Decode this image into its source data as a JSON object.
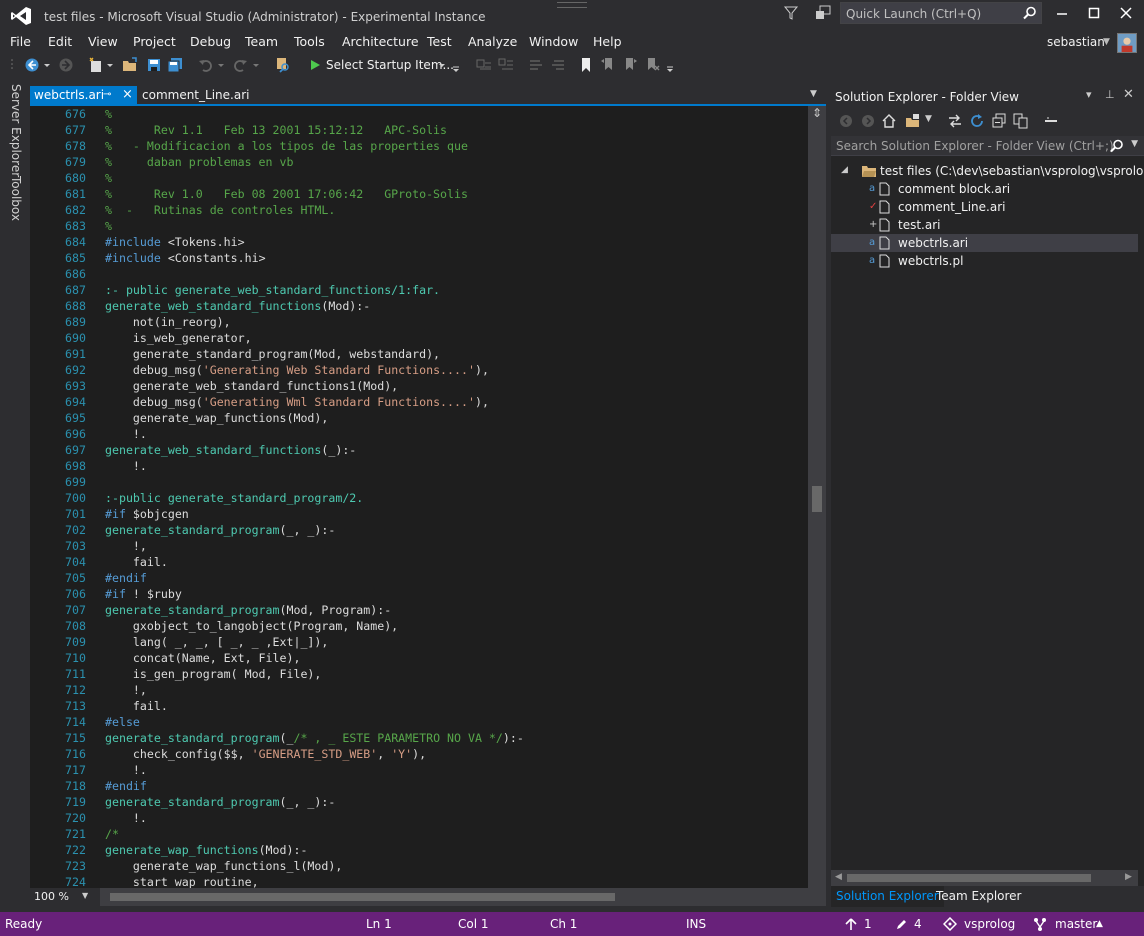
{
  "window": {
    "title": "test files - Microsoft Visual Studio (Administrator) - Experimental Instance",
    "quick_launch_placeholder": "Quick Launch (Ctrl+Q)"
  },
  "menu": [
    "File",
    "Edit",
    "View",
    "Project",
    "Debug",
    "Team",
    "Tools",
    "Architecture",
    "Test",
    "Analyze",
    "Window",
    "Help"
  ],
  "user": {
    "name": "sebastian"
  },
  "toolbar": {
    "startup_label": "Select Startup Item..."
  },
  "left_rail": {
    "server_explorer": "Server Explorer",
    "toolbox": "Toolbox"
  },
  "tabs": {
    "active": {
      "label": "webctrls.ari",
      "pin": "⊸",
      "close": "×"
    },
    "inactive": {
      "label": "comment_Line.ari"
    }
  },
  "editor": {
    "zoom": "100 %",
    "lines": [
      {
        "n": "676",
        "seg": [
          {
            "c": "c-com",
            "t": "%"
          }
        ]
      },
      {
        "n": "677",
        "seg": [
          {
            "c": "c-com",
            "t": "%      Rev 1.1   Feb 13 2001 15:12:12   APC-Solis"
          }
        ]
      },
      {
        "n": "678",
        "seg": [
          {
            "c": "c-com",
            "t": "%   - Modificacion a los tipos de las properties que"
          }
        ]
      },
      {
        "n": "679",
        "seg": [
          {
            "c": "c-com",
            "t": "%     daban problemas en vb"
          }
        ]
      },
      {
        "n": "680",
        "seg": [
          {
            "c": "c-com",
            "t": "%"
          }
        ]
      },
      {
        "n": "681",
        "seg": [
          {
            "c": "c-com",
            "t": "%      Rev 1.0   Feb 08 2001 17:06:42   GProto-Solis"
          }
        ]
      },
      {
        "n": "682",
        "seg": [
          {
            "c": "c-com",
            "t": "%  -   Rutinas de controles HTML."
          }
        ]
      },
      {
        "n": "683",
        "seg": [
          {
            "c": "c-com",
            "t": "%"
          }
        ]
      },
      {
        "n": "684",
        "seg": [
          {
            "c": "c-dir",
            "t": "#include"
          },
          {
            "c": "c-plain",
            "t": " <Tokens.hi>"
          }
        ]
      },
      {
        "n": "685",
        "seg": [
          {
            "c": "c-dir",
            "t": "#include"
          },
          {
            "c": "c-plain",
            "t": " <Constants.hi>"
          }
        ]
      },
      {
        "n": "686",
        "seg": []
      },
      {
        "n": "687",
        "seg": [
          {
            "c": "c-pub",
            "t": ":- public generate_web_standard_functions/1:far."
          }
        ]
      },
      {
        "n": "688",
        "seg": [
          {
            "c": "c-fn",
            "t": "generate_web_standard_functions"
          },
          {
            "c": "c-plain",
            "t": "(Mod):-"
          }
        ]
      },
      {
        "n": "689",
        "seg": [
          {
            "c": "c-plain",
            "t": "    not(in_reorg),"
          }
        ]
      },
      {
        "n": "690",
        "seg": [
          {
            "c": "c-plain",
            "t": "    is_web_generator,"
          }
        ]
      },
      {
        "n": "691",
        "seg": [
          {
            "c": "c-plain",
            "t": "    generate_standard_program(Mod, webstandard),"
          }
        ]
      },
      {
        "n": "692",
        "seg": [
          {
            "c": "c-plain",
            "t": "    debug_msg("
          },
          {
            "c": "c-str",
            "t": "'Generating Web Standard Functions....'"
          },
          {
            "c": "c-plain",
            "t": "),"
          }
        ]
      },
      {
        "n": "693",
        "seg": [
          {
            "c": "c-plain",
            "t": "    generate_web_standard_functions1(Mod),"
          }
        ]
      },
      {
        "n": "694",
        "seg": [
          {
            "c": "c-plain",
            "t": "    debug_msg("
          },
          {
            "c": "c-str",
            "t": "'Generating Wml Standard Functions....'"
          },
          {
            "c": "c-plain",
            "t": "),"
          }
        ]
      },
      {
        "n": "695",
        "seg": [
          {
            "c": "c-plain",
            "t": "    generate_wap_functions(Mod),"
          }
        ]
      },
      {
        "n": "696",
        "seg": [
          {
            "c": "c-plain",
            "t": "    !."
          }
        ]
      },
      {
        "n": "697",
        "seg": [
          {
            "c": "c-fn",
            "t": "generate_web_standard_functions"
          },
          {
            "c": "c-plain",
            "t": "(_):-"
          }
        ]
      },
      {
        "n": "698",
        "seg": [
          {
            "c": "c-plain",
            "t": "    !."
          }
        ]
      },
      {
        "n": "699",
        "seg": []
      },
      {
        "n": "700",
        "seg": [
          {
            "c": "c-pub",
            "t": ":-public generate_standard_program/2."
          }
        ]
      },
      {
        "n": "701",
        "seg": [
          {
            "c": "c-dir",
            "t": "#if"
          },
          {
            "c": "c-plain",
            "t": " $objcgen"
          }
        ]
      },
      {
        "n": "702",
        "seg": [
          {
            "c": "c-fn",
            "t": "generate_standard_program"
          },
          {
            "c": "c-plain",
            "t": "(_, _):-"
          }
        ]
      },
      {
        "n": "703",
        "seg": [
          {
            "c": "c-plain",
            "t": "    !,"
          }
        ]
      },
      {
        "n": "704",
        "seg": [
          {
            "c": "c-plain",
            "t": "    fail."
          }
        ]
      },
      {
        "n": "705",
        "seg": [
          {
            "c": "c-dir",
            "t": "#endif"
          }
        ]
      },
      {
        "n": "706",
        "seg": [
          {
            "c": "c-dir",
            "t": "#if"
          },
          {
            "c": "c-plain",
            "t": " ! $ruby"
          }
        ]
      },
      {
        "n": "707",
        "seg": [
          {
            "c": "c-fn",
            "t": "generate_standard_program"
          },
          {
            "c": "c-plain",
            "t": "(Mod, Program):-"
          }
        ]
      },
      {
        "n": "708",
        "seg": [
          {
            "c": "c-plain",
            "t": "    gxobject_to_langobject(Program, Name),"
          }
        ]
      },
      {
        "n": "709",
        "seg": [
          {
            "c": "c-plain",
            "t": "    lang( _, _, [ _, _ ,Ext|_]),"
          }
        ]
      },
      {
        "n": "710",
        "seg": [
          {
            "c": "c-plain",
            "t": "    concat(Name, Ext, File),"
          }
        ]
      },
      {
        "n": "711",
        "seg": [
          {
            "c": "c-plain",
            "t": "    is_gen_program( Mod, File),"
          }
        ]
      },
      {
        "n": "712",
        "seg": [
          {
            "c": "c-plain",
            "t": "    !,"
          }
        ]
      },
      {
        "n": "713",
        "seg": [
          {
            "c": "c-plain",
            "t": "    fail."
          }
        ]
      },
      {
        "n": "714",
        "seg": [
          {
            "c": "c-dir",
            "t": "#else"
          }
        ]
      },
      {
        "n": "715",
        "seg": [
          {
            "c": "c-fn",
            "t": "generate_standard_program"
          },
          {
            "c": "c-plain",
            "t": "(_"
          },
          {
            "c": "c-com",
            "t": "/* , _ ESTE PARAMETRO NO VA */"
          },
          {
            "c": "c-plain",
            "t": "):-"
          }
        ]
      },
      {
        "n": "716",
        "seg": [
          {
            "c": "c-plain",
            "t": "    check_config($$, "
          },
          {
            "c": "c-str",
            "t": "'GENERATE_STD_WEB'"
          },
          {
            "c": "c-plain",
            "t": ", "
          },
          {
            "c": "c-str",
            "t": "'Y'"
          },
          {
            "c": "c-plain",
            "t": "),"
          }
        ]
      },
      {
        "n": "717",
        "seg": [
          {
            "c": "c-plain",
            "t": "    !."
          }
        ]
      },
      {
        "n": "718",
        "seg": [
          {
            "c": "c-dir",
            "t": "#endif"
          }
        ]
      },
      {
        "n": "719",
        "seg": [
          {
            "c": "c-fn",
            "t": "generate_standard_program"
          },
          {
            "c": "c-plain",
            "t": "(_, _):-"
          }
        ]
      },
      {
        "n": "720",
        "seg": [
          {
            "c": "c-plain",
            "t": "    !."
          }
        ]
      },
      {
        "n": "721",
        "seg": [
          {
            "c": "c-com",
            "t": "/*"
          }
        ]
      },
      {
        "n": "722",
        "seg": [
          {
            "c": "c-fn",
            "t": "generate_wap_functions"
          },
          {
            "c": "c-plain",
            "t": "(Mod):-"
          }
        ]
      },
      {
        "n": "723",
        "seg": [
          {
            "c": "c-plain",
            "t": "    generate_wap_functions_l(Mod),"
          }
        ]
      },
      {
        "n": "724",
        "seg": [
          {
            "c": "c-plain",
            "t": "    start_wap_routine,"
          }
        ]
      }
    ]
  },
  "solution_explorer": {
    "title": "Solution Explorer - Folder View",
    "search_placeholder": "Search Solution Explorer - Folder View (Ctrl+;)",
    "root": "test files (C:\\dev\\sebastian\\vsprolog\\vsprolog\\te",
    "files": [
      {
        "name": "comment block.ari",
        "status": "a",
        "status_color": "#569cd6",
        "selected": false
      },
      {
        "name": "comment_Line.ari",
        "status": "✓",
        "status_color": "#e04040",
        "selected": false
      },
      {
        "name": "test.ari",
        "status": "+",
        "status_color": "#c8c8c8",
        "selected": false
      },
      {
        "name": "webctrls.ari",
        "status": "a",
        "status_color": "#569cd6",
        "selected": true
      },
      {
        "name": "webctrls.pl",
        "status": "a",
        "status_color": "#569cd6",
        "selected": false
      }
    ],
    "tabs": {
      "solution_explorer": "Solution Explorer",
      "team_explorer": "Team Explorer"
    }
  },
  "statusbar": {
    "ready": "Ready",
    "ln": "Ln 1",
    "col": "Col 1",
    "ch": "Ch 1",
    "ins": "INS",
    "up": "1",
    "edits": "4",
    "repo": "vsprolog",
    "branch": "master"
  },
  "colors": {
    "accent": "#007acc",
    "statusbar": "#68217a",
    "editor_bg": "#1e1e1e"
  }
}
